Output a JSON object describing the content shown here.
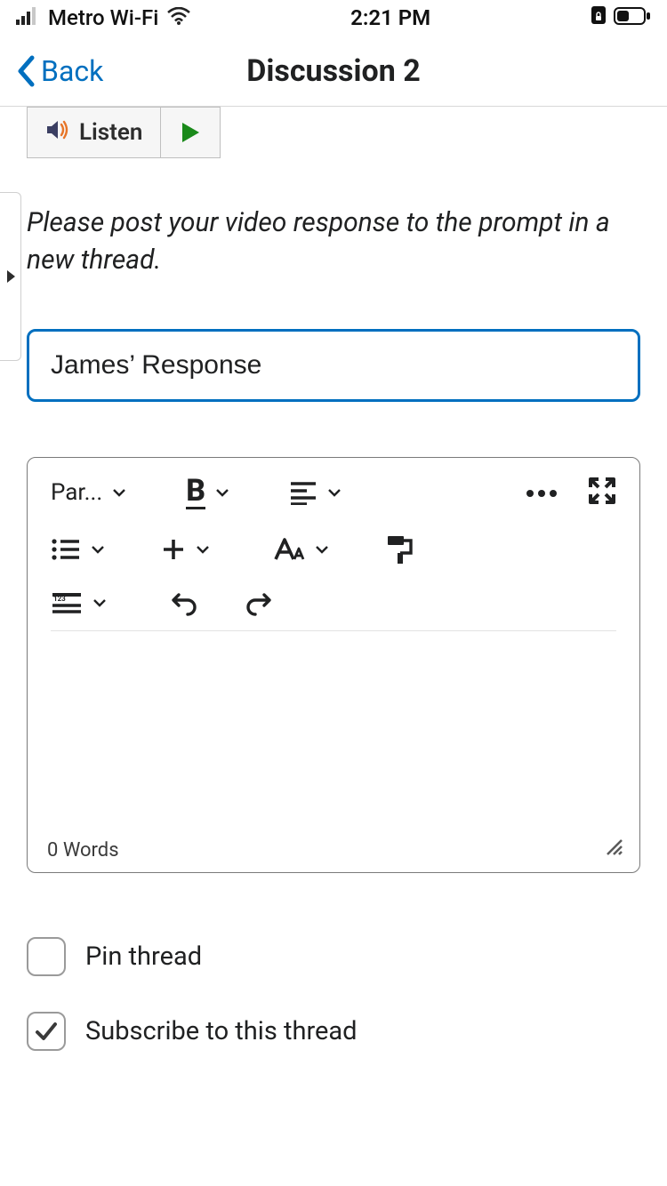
{
  "status": {
    "carrier": "Metro Wi-Fi",
    "time": "2:21 PM"
  },
  "nav": {
    "back": "Back",
    "title": "Discussion 2"
  },
  "listen": {
    "label": "Listen"
  },
  "prompt": "Please post your video response to the prompt in a new thread.",
  "title_input": {
    "value": "James’ Response"
  },
  "editor": {
    "paragraph_label": "Par...",
    "word_count": "0 Words"
  },
  "options": {
    "pin": {
      "label": "Pin thread",
      "checked": false
    },
    "subscribe": {
      "label": "Subscribe to this thread",
      "checked": true
    }
  }
}
